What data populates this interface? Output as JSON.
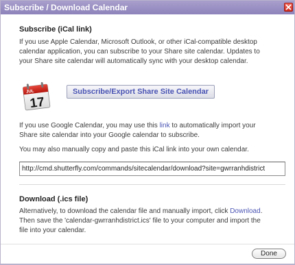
{
  "dialog": {
    "title": "Subscribe / Download Calendar",
    "close_icon": "close-icon"
  },
  "subscribe_section": {
    "title": "Subscribe (iCal link)",
    "description_lines": [
      "If you use Apple Calendar, Microsoft Outlook, or other iCal-compatible desktop",
      "calendar application, you can subscribe to your Share site calendar. Updates to",
      "your Share site calendar will automatically sync with your desktop calendar."
    ],
    "calendar_icon": {
      "name": "calendar-icon",
      "month": "JUL",
      "day": "17"
    },
    "subscribe_button_label": "Subscribe/Export Share Site Calendar",
    "google": {
      "line1_before": "If you use Google Calendar, you may use this ",
      "line1_link": "link",
      "line1_after": " to automatically import your",
      "line2": "Share site calendar into your Google calendar to subscribe."
    },
    "manual_copy_text": "You may also manually copy and paste this iCal link into your own calendar.",
    "ical_link_value": "http://cmd.shutterfly.com/commands/sitecalendar/download?site=gwrranhdistrict"
  },
  "download_section": {
    "title": "Download (.ics file)",
    "line1_before": "Alternatively, to download the calendar file and manually import, click ",
    "line1_link": "Download",
    "line1_after": ".",
    "line2": "Then save the 'calendar-gwrranhdistrict.ics' file to your computer and import the",
    "line3": "file into your calendar."
  },
  "footer": {
    "done_label": "Done"
  },
  "colors": {
    "titlebar": "#9a90c3",
    "link": "#4a54b3",
    "close_button": "#d93a2c"
  }
}
